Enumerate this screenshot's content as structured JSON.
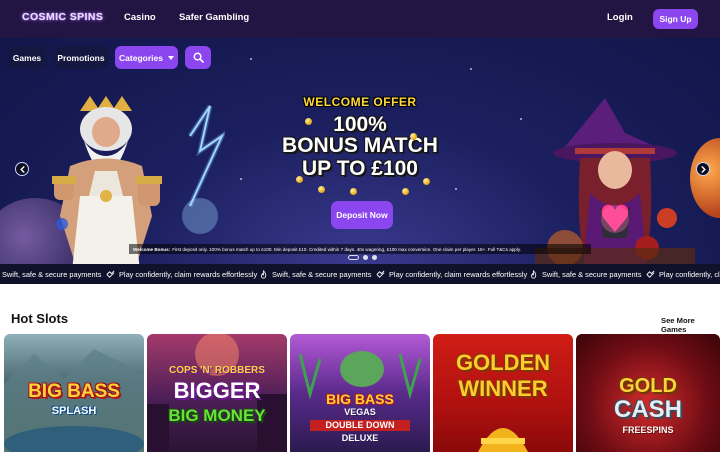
{
  "header": {
    "logo": "COSMIC SPINS",
    "nav": [
      "Casino",
      "Safer Gambling"
    ],
    "login_label": "Login",
    "signup_label": "Sign Up"
  },
  "subnav": {
    "games_label": "Games",
    "promotions_label": "Promotions",
    "categories_label": "Categories"
  },
  "hero": {
    "welcome": "WELCOME OFFER",
    "line1": "100%",
    "line2": "BONUS MATCH",
    "line3": "UP TO £100",
    "deposit_label": "Deposit Now",
    "terms_bold": "Welcome Bonus:",
    "terms_text": "First deposit only. 100% bonus match up to £100. Min deposit £10. Credited within 7 days. 40x wagering, £100 max conversion. One claim per player. 18+. Full T&Cs apply.",
    "slide_count": 3,
    "active_slide": 1
  },
  "ticker": [
    "Swift, safe & secure payments",
    "Play confidently, claim rewards effortlessly",
    "Swift, safe & secure payments",
    "Play confidently, claim rewards effortlessly",
    "Swift, safe & secure payments",
    "Play confidently, claim rewards effortlessly"
  ],
  "hot_slots": {
    "title": "Hot Slots",
    "see_more": "See More Games",
    "games": [
      {
        "name": "BIG BASS",
        "sub": "SPLASH"
      },
      {
        "name": "COPS 'N' ROBBERS",
        "sub": "BIGGER",
        "sub2": "BIG MONEY"
      },
      {
        "name": "BIG BASS",
        "sub": "VEGAS",
        "sub2": "DOUBLE DOWN",
        "sub3": "DELUXE"
      },
      {
        "name": "GOLDEN",
        "sub": "WINNER"
      },
      {
        "name": "GOLD",
        "sub": "CASH",
        "sub2": "FREESPINS"
      }
    ]
  },
  "colors": {
    "header_bg": "#221443",
    "accent": "#8b46f0",
    "ticker_bg": "#10122b"
  }
}
